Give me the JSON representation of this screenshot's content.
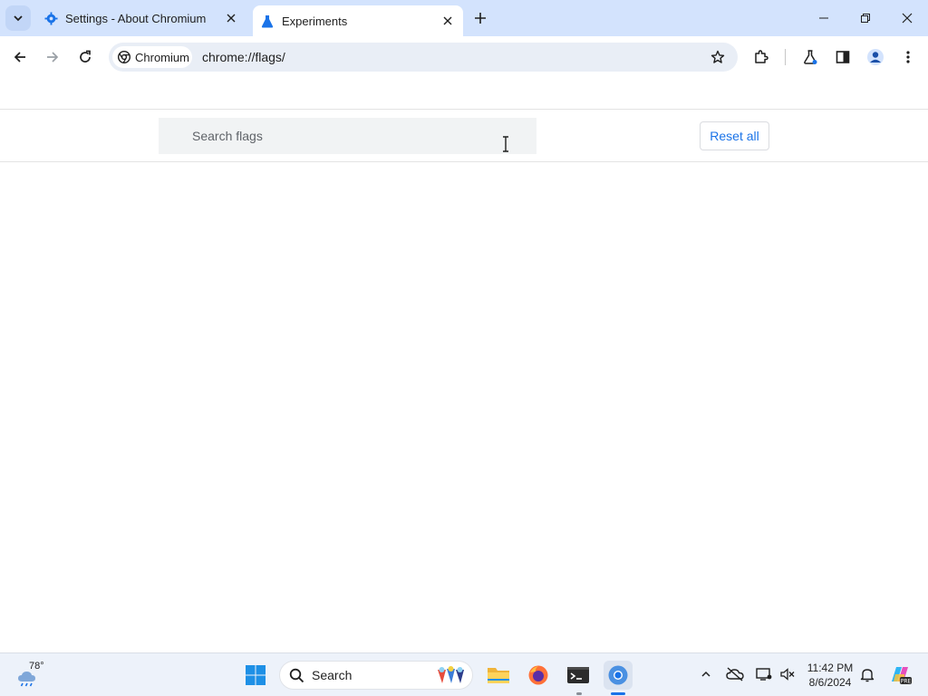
{
  "tabs": [
    {
      "title": "Settings - About Chromium",
      "icon": "gear-icon",
      "active": false
    },
    {
      "title": "Experiments",
      "icon": "flask-icon",
      "active": true
    }
  ],
  "toolbar": {
    "site_chip": "Chromium",
    "url": "chrome://flags/"
  },
  "flags": {
    "search_placeholder": "Search flags",
    "reset_all_label": "Reset all"
  },
  "taskbar": {
    "weather_temp": "78°",
    "search_label": "Search",
    "clock_time": "11:42 PM",
    "clock_date": "8/6/2024"
  },
  "colors": {
    "titlebar_bg": "#d3e3fd",
    "omnibox_bg": "#e9eef6",
    "link_blue": "#1a73e8",
    "taskbar_bg": "#edf2fa"
  }
}
